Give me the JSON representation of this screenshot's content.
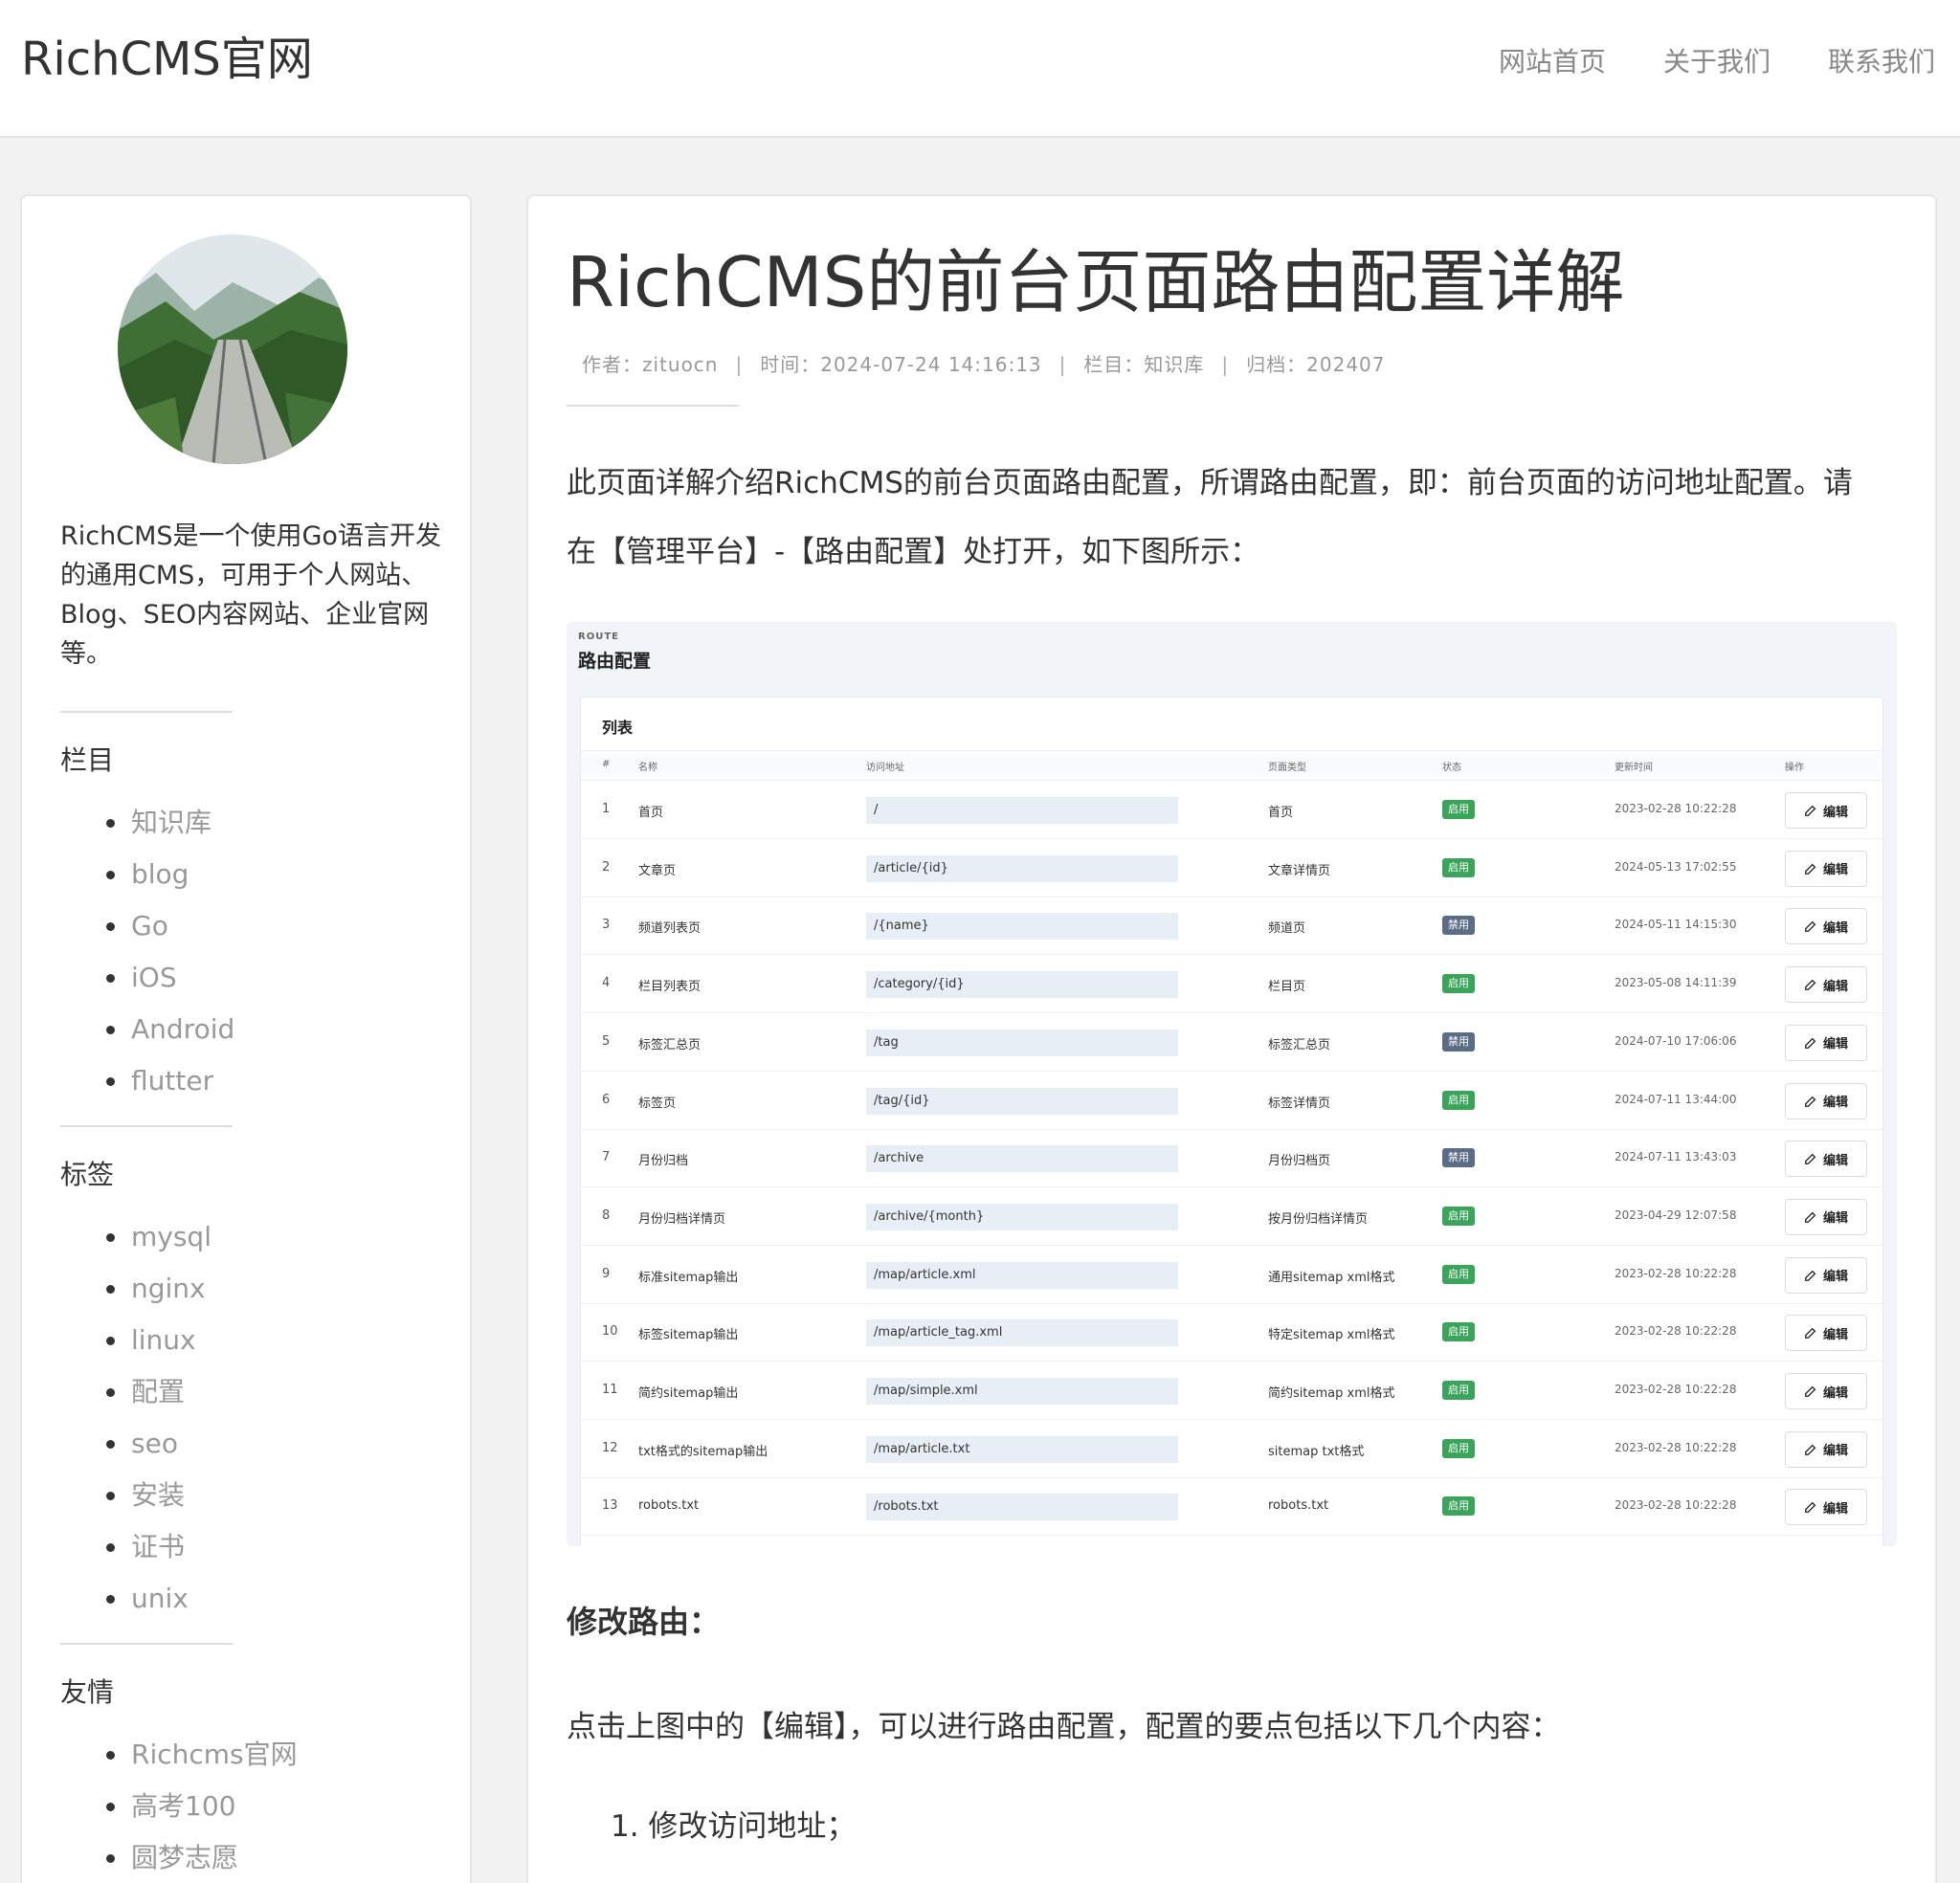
{
  "header": {
    "logo": "RichCMS官网",
    "nav": [
      "网站首页",
      "关于我们",
      "联系我们"
    ]
  },
  "sidebar": {
    "description": "RichCMS是一个使用Go语言开发的通用CMS，可用于个人网站、Blog、SEO内容网站、企业官网等。",
    "categories": {
      "heading": "栏目",
      "items": [
        "知识库",
        "blog",
        "Go",
        "iOS",
        "Android",
        "flutter"
      ]
    },
    "tags": {
      "heading": "标签",
      "items": [
        "mysql",
        "nginx",
        "linux",
        "配置",
        "seo",
        "安装",
        "证书",
        "unix"
      ]
    },
    "links": {
      "heading": "友情",
      "items": [
        "Richcms官网",
        "高考100",
        "圆梦志愿"
      ]
    }
  },
  "article": {
    "title": "RichCMS的前台页面路由配置详解",
    "meta": {
      "author": "作者：zituocn",
      "time": "时间：2024-07-24 14:16:13",
      "category": "栏目：知识库",
      "archive": "归档：202407"
    },
    "intro_1": "此页面详解介绍RichCMS的前台页面路由配置，所谓路由配置，即：前台页面的访问地址配置。请",
    "intro_2": "在【管理平台】-【路由配置】处打开，如下图所示：",
    "section_heading": "修改路由：",
    "click_text": "点击上图中的【编辑】，可以进行路由配置，配置的要点包括以下几个内容：",
    "list_item_1": "1. 修改访问地址；"
  },
  "screenshot": {
    "sub": "ROUTE",
    "heading": "路由配置",
    "card_title": "列表",
    "columns": [
      "#",
      "名称",
      "访问地址",
      "页面类型",
      "状态",
      "更新时间",
      "操作"
    ],
    "edit_label": "编辑",
    "colors": {
      "enabled": "#3aa55a",
      "disabled": "#5b6c86"
    },
    "rows": [
      {
        "n": "1",
        "name": "首页",
        "path": "/",
        "type": "首页",
        "status": "启用",
        "time": "2023-02-28 10:22:28"
      },
      {
        "n": "2",
        "name": "文章页",
        "path": "/article/{id}",
        "type": "文章详情页",
        "status": "启用",
        "time": "2024-05-13 17:02:55"
      },
      {
        "n": "3",
        "name": "频道列表页",
        "path": "/{name}",
        "type": "频道页",
        "status": "禁用",
        "time": "2024-05-11 14:15:30"
      },
      {
        "n": "4",
        "name": "栏目列表页",
        "path": "/category/{id}",
        "type": "栏目页",
        "status": "启用",
        "time": "2023-05-08 14:11:39"
      },
      {
        "n": "5",
        "name": "标签汇总页",
        "path": "/tag",
        "type": "标签汇总页",
        "status": "禁用",
        "time": "2024-07-10 17:06:06"
      },
      {
        "n": "6",
        "name": "标签页",
        "path": "/tag/{id}",
        "type": "标签详情页",
        "status": "启用",
        "time": "2024-07-11 13:44:00"
      },
      {
        "n": "7",
        "name": "月份归档",
        "path": "/archive",
        "type": "月份归档页",
        "status": "禁用",
        "time": "2024-07-11 13:43:03"
      },
      {
        "n": "8",
        "name": "月份归档详情页",
        "path": "/archive/{month}",
        "type": "按月份归档详情页",
        "status": "启用",
        "time": "2023-04-29 12:07:58"
      },
      {
        "n": "9",
        "name": "标准sitemap输出",
        "path": "/map/article.xml",
        "type": "通用sitemap xml格式",
        "status": "启用",
        "time": "2023-02-28 10:22:28"
      },
      {
        "n": "10",
        "name": "标签sitemap输出",
        "path": "/map/article_tag.xml",
        "type": "特定sitemap xml格式",
        "status": "启用",
        "time": "2023-02-28 10:22:28"
      },
      {
        "n": "11",
        "name": "简约sitemap输出",
        "path": "/map/simple.xml",
        "type": "简约sitemap xml格式",
        "status": "启用",
        "time": "2023-02-28 10:22:28"
      },
      {
        "n": "12",
        "name": "txt格式的sitemap输出",
        "path": "/map/article.txt",
        "type": "sitemap txt格式",
        "status": "启用",
        "time": "2023-02-28 10:22:28"
      },
      {
        "n": "13",
        "name": "robots.txt",
        "path": "/robots.txt",
        "type": "robots.txt",
        "status": "启用",
        "time": "2023-02-28 10:22:28"
      }
    ]
  }
}
